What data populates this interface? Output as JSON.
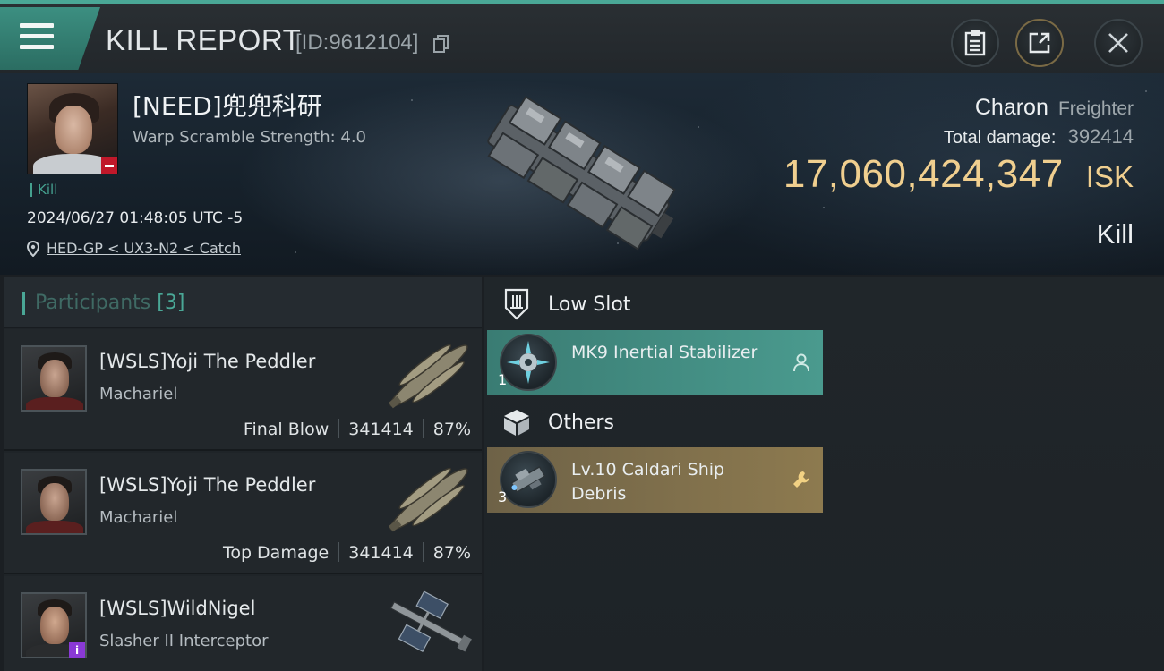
{
  "header": {
    "title": "KILL REPORT",
    "report_id": "[ID:9612104]",
    "icons": [
      "menu-icon",
      "copy-icon",
      "clipboard-icon",
      "share-icon",
      "close-icon"
    ]
  },
  "victim": {
    "name": "[NEED]兜兜科研",
    "subtitle": "Warp Scramble Strength: 4.0",
    "tag": "Kill",
    "datetime": "2024/06/27 01:48:05 UTC -5",
    "location": "HED-GP < UX3-N2 < Catch",
    "ship_name": "Charon",
    "ship_class": "Freighter",
    "damage_label": "Total damage:",
    "damage_value": "392414",
    "isk_value": "17,060,424,347",
    "isk_unit": "ISK",
    "result": "Kill"
  },
  "participants": {
    "label": "Participants",
    "count": "[3]",
    "rows": [
      {
        "name": "[WSLS]Yoji The Peddler",
        "ship": "Machariel",
        "role": "Final Blow",
        "damage": "341414",
        "percent": "87%"
      },
      {
        "name": "[WSLS]Yoji The Peddler",
        "ship": "Machariel",
        "role": "Top Damage",
        "damage": "341414",
        "percent": "87%"
      },
      {
        "name": "[WSLS]WildNigel",
        "ship": "Slasher II Interceptor",
        "badge": "i"
      }
    ]
  },
  "fitting": {
    "sections": [
      {
        "label": "Low Slot",
        "icon": "low-slot-icon",
        "items": [
          {
            "name": "MK9 Inertial Stabilizer",
            "qty": "1",
            "status": "fitted",
            "color": "#4a9a8e"
          }
        ]
      },
      {
        "label": "Others",
        "icon": "cargo-box-icon",
        "items": [
          {
            "name": "Lv.10 Caldari Ship Debris",
            "qty": "3",
            "status": "dropped",
            "color": "#8d7a4f"
          }
        ]
      }
    ]
  },
  "colors": {
    "accent": "#4aa796",
    "isk": "#f0cf8f",
    "standing_negative": "#c0182a",
    "badge_purple": "#8a39d6"
  }
}
